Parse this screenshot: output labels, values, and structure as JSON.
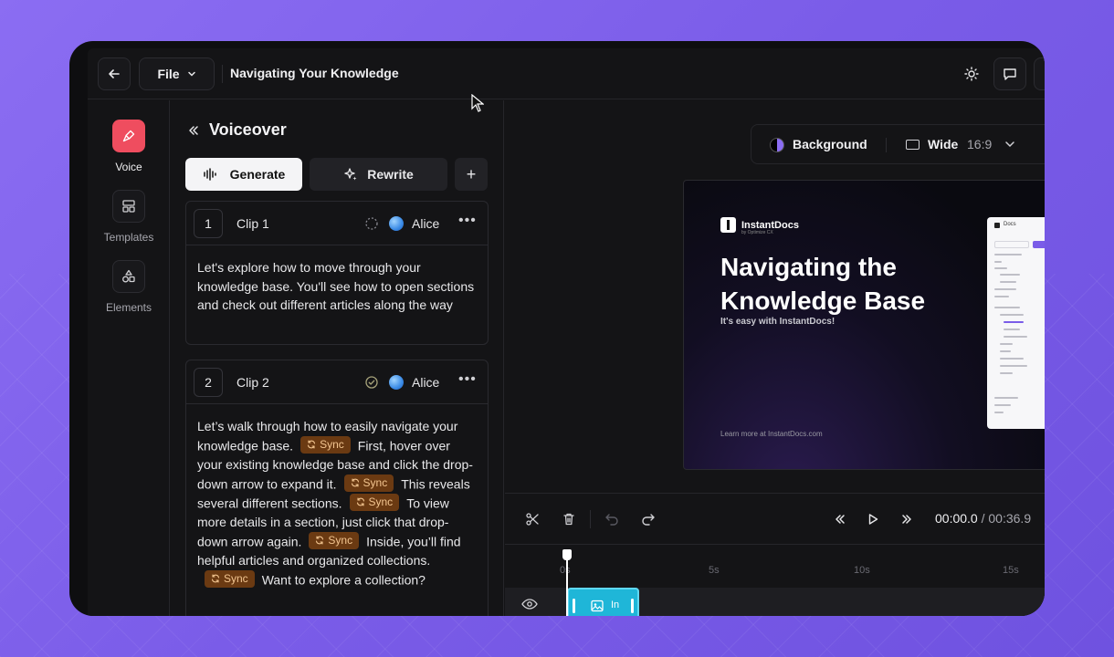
{
  "topbar": {
    "file_label": "File",
    "doc_title": "Navigating Your Knowledge"
  },
  "rail": {
    "items": [
      {
        "label": "Voice",
        "icon": "mic-icon"
      },
      {
        "label": "Templates",
        "icon": "layout-icon"
      },
      {
        "label": "Elements",
        "icon": "shapes-icon"
      }
    ]
  },
  "voiceover": {
    "title": "Voiceover",
    "generate_label": "Generate",
    "rewrite_label": "Rewrite",
    "add_label": "+",
    "clips": [
      {
        "num": "1",
        "name": "Clip 1",
        "voice": "Alice",
        "text": "Let's explore how to move through your knowledge base. You'll see how to open sections and check out different articles along the way"
      },
      {
        "num": "2",
        "name": "Clip 2",
        "voice": "Alice",
        "sync_label": "Sync",
        "segments": [
          "Let’s walk through how to easily navigate your knowledge base.",
          "First, hover over your existing knowledge base and click the drop-down arrow to expand it.",
          "This reveals several different sections.",
          "To view more details in a section, just click that drop-down arrow again.",
          "Inside, you’ll find helpful articles and organized collections.",
          "Want to explore a collection?"
        ]
      }
    ]
  },
  "canvas": {
    "background_label": "Background",
    "format_label": "Wide",
    "format_ratio": "16:9"
  },
  "slide": {
    "brand": "InstantDocs",
    "brand_sub": "by Optimize CX",
    "title": "Navigating the Knowledge Base",
    "subtitle": "It's easy with InstantDocs!",
    "footer": "Learn more at InstantDocs.com",
    "mock_header": "Docs"
  },
  "playback": {
    "current": "00:00.0",
    "separator": "/",
    "total": "00:36.9"
  },
  "timeline": {
    "ticks": [
      "0s",
      "5s",
      "10s",
      "15s"
    ],
    "clip_label": "In"
  }
}
